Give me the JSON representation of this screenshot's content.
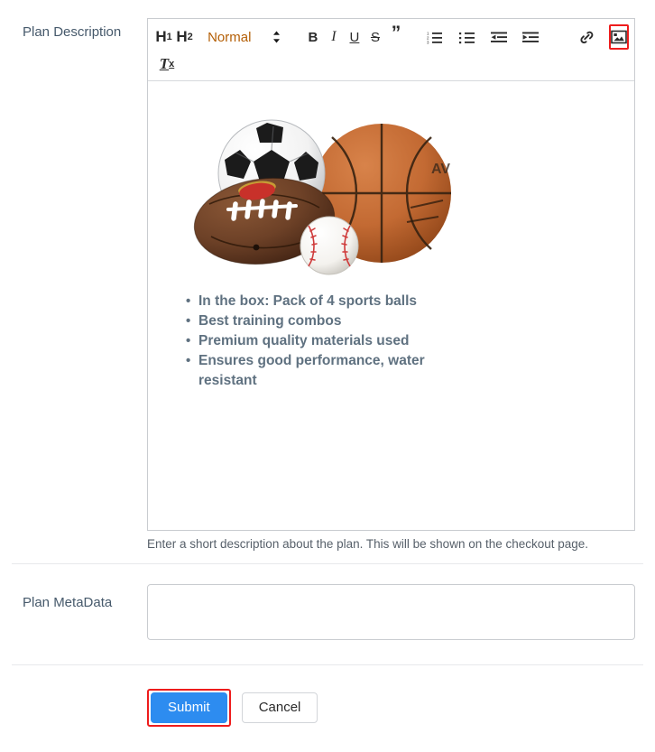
{
  "form": {
    "description": {
      "label": "Plan Description",
      "help_text": "Enter a short description about the plan. This will be shown on the checkout page."
    },
    "metadata": {
      "label": "Plan MetaData",
      "value": "",
      "placeholder": ""
    }
  },
  "editor": {
    "toolbar": {
      "heading1": "H",
      "heading1_sub": "1",
      "heading2": "H",
      "heading2_sub": "2",
      "format_picker_value": "Normal",
      "format_picker_color": "#b45f06",
      "bold": "B",
      "italic": "I",
      "underline": "U",
      "strike": "S",
      "blockquote": "”",
      "ordered_list": "ordered-list-icon",
      "bullet_list": "bullet-list-icon",
      "outdent": "outdent-icon",
      "indent": "indent-icon",
      "link": "link-icon",
      "image": "image-icon",
      "clear_format": "T",
      "clear_format_sub": "x",
      "selected_button": "image",
      "selection_highlight_color": "#ee1c1c"
    },
    "content": {
      "image_alt": "Pack of 4 sports balls: soccer ball, basketball, american football and baseball",
      "bullets": [
        "In the box: Pack of 4 sports balls",
        "Best training combos",
        "Premium quality materials used",
        "Ensures good performance, water resistant"
      ],
      "text_color": "#5f7180"
    }
  },
  "actions": {
    "submit_label": "Submit",
    "cancel_label": "Cancel",
    "submit_color": "#2d8cf0",
    "submit_highlight_color": "#ee1c1c"
  }
}
